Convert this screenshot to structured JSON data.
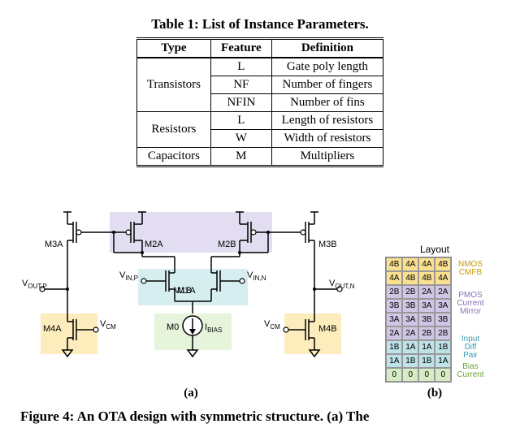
{
  "table": {
    "caption": "Table 1: List of Instance Parameters.",
    "headers": [
      "Type",
      "Feature",
      "Definition"
    ],
    "rows": [
      {
        "type": "Transistors",
        "span": 3,
        "feature": "L",
        "def": "Gate poly length"
      },
      {
        "feature": "NF",
        "def": "Number of fingers"
      },
      {
        "feature": "NFIN",
        "def": "Number of fins"
      },
      {
        "type": "Resistors",
        "span": 2,
        "feature": "L",
        "def": "Length of resistors"
      },
      {
        "feature": "W",
        "def": "Width of resistors"
      },
      {
        "type": "Capacitors",
        "span": 1,
        "feature": "M",
        "def": "Multipliers"
      }
    ]
  },
  "circuit": {
    "devices": {
      "M0": "M0",
      "M1A": "M1A",
      "M1B": "M1B",
      "M2A": "M2A",
      "M2B": "M2B",
      "M3A": "M3A",
      "M3B": "M3B",
      "M4A": "M4A",
      "M4B": "M4B"
    },
    "nets": {
      "VOUTP": "V",
      "VOUTP_sub": "OUT,P",
      "VOUTN": "V",
      "VOUTN_sub": "OUT,N",
      "VINP": "V",
      "VINP_sub": "IN,P",
      "VINN": "V",
      "VINN_sub": "IN,N",
      "VCM_L": "V",
      "VCM_L_sub": "CM",
      "VCM_R": "V",
      "VCM_R_sub": "CM",
      "IBIAS": "I",
      "IBIAS_sub": "BIAS"
    },
    "labels": {
      "a": "(a)",
      "b": "(b)"
    }
  },
  "layout": {
    "title": "Layout",
    "grid": [
      [
        "4B",
        "4A",
        "4A",
        "4B"
      ],
      [
        "4A",
        "4B",
        "4B",
        "4A"
      ],
      [
        "2B",
        "2B",
        "2A",
        "2A"
      ],
      [
        "3B",
        "3B",
        "3A",
        "3A"
      ],
      [
        "3A",
        "3A",
        "3B",
        "3B"
      ],
      [
        "2A",
        "2A",
        "2B",
        "2B"
      ],
      [
        "1B",
        "1A",
        "1A",
        "1B"
      ],
      [
        "1A",
        "1B",
        "1B",
        "1A"
      ],
      [
        "0",
        "0",
        "0",
        "0"
      ]
    ],
    "classes": [
      "c-nmos",
      "c-nmos",
      "c-pmos",
      "c-pmos",
      "c-pmos",
      "c-pmos",
      "c-diff",
      "c-diff",
      "c-bias"
    ],
    "legend": {
      "nmos": "NMOS CMFB",
      "pmos": "PMOS Current Mirror",
      "diff": "Input Diff Pair",
      "bias": "Bias Current"
    }
  },
  "figcaption": "Figure 4: An OTA design with symmetric structure. (a) The"
}
